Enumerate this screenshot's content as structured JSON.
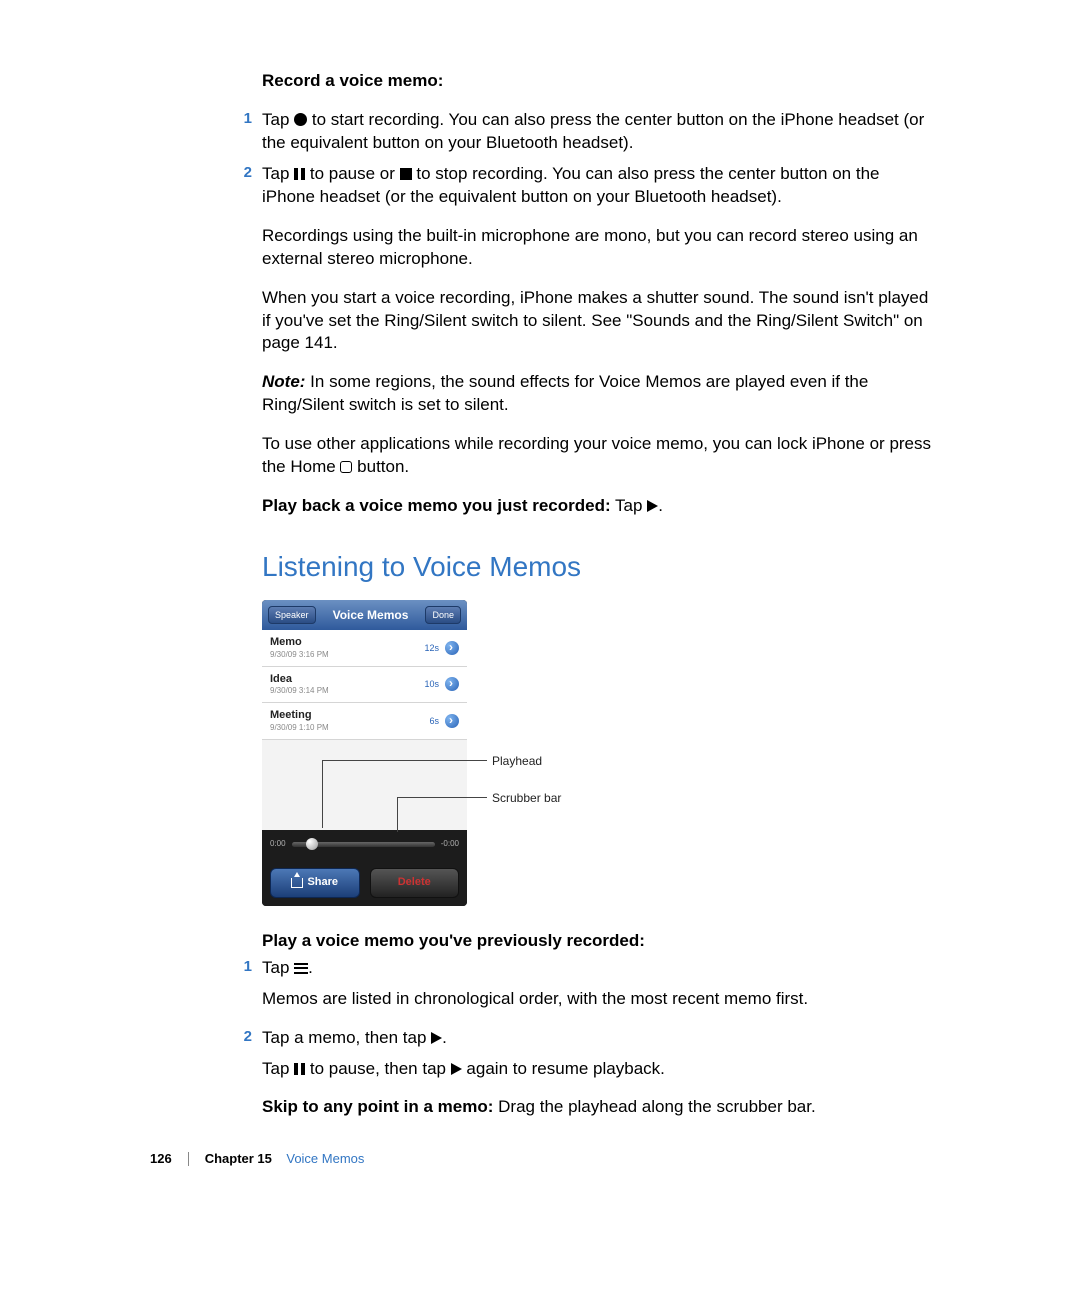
{
  "section1": {
    "title": "Record a voice memo:",
    "step1_a": "Tap ",
    "step1_b": " to start recording. You can also press the center button on the iPhone headset (or the equivalent button on your Bluetooth headset).",
    "step2_a": "Tap ",
    "step2_b": " to pause or ",
    "step2_c": " to stop recording. You can also press the center button on the iPhone headset (or the equivalent button on your Bluetooth headset).",
    "para_mono": "Recordings using the built-in microphone are mono, but you can record stereo using an external stereo microphone.",
    "para_shutter": "When you start a voice recording, iPhone makes a shutter sound. The sound isn't played if you've set the Ring/Silent switch to silent. See \"Sounds and the Ring/Silent Switch\" on page 141.",
    "note_label": "Note:",
    "note_body": "  In some regions, the sound effects for Voice Memos are played even if the Ring/Silent switch is set to silent.",
    "para_other_a": "To use other applications while recording your voice memo, you can lock iPhone or press the Home ",
    "para_other_b": " button.",
    "playback_label": "Play back a voice memo you just recorded:",
    "playback_body": "  Tap "
  },
  "h2": "Listening to Voice Memos",
  "phone": {
    "speaker": "Speaker",
    "title": "Voice Memos",
    "done": "Done",
    "rows": [
      {
        "title": "Memo",
        "sub": "9/30/09 3:16 PM",
        "dur": "12s"
      },
      {
        "title": "Idea",
        "sub": "9/30/09 3:14 PM",
        "dur": "10s"
      },
      {
        "title": "Meeting",
        "sub": "9/30/09 1:10 PM",
        "dur": "6s"
      }
    ],
    "time_left": "0:00",
    "time_right": "-0:00",
    "share": "Share",
    "del": "Delete"
  },
  "callouts": {
    "playhead": "Playhead",
    "scrubber": "Scrubber bar"
  },
  "section2": {
    "title": "Play a voice memo you've previously recorded:",
    "s1": "Tap ",
    "after_list": "Memos are listed in chronological order, with the most recent memo first.",
    "s2": "Tap a memo, then tap ",
    "resume_a": "Tap ",
    "resume_b": " to pause, then tap ",
    "resume_c": " again to resume playback.",
    "skip_label": "Skip to any point in a memo:",
    "skip_body": "  Drag the playhead along the scrubber bar."
  },
  "footer": {
    "page": "126",
    "chapter_label": "Chapter 15",
    "chapter_name": "Voice Memos"
  }
}
